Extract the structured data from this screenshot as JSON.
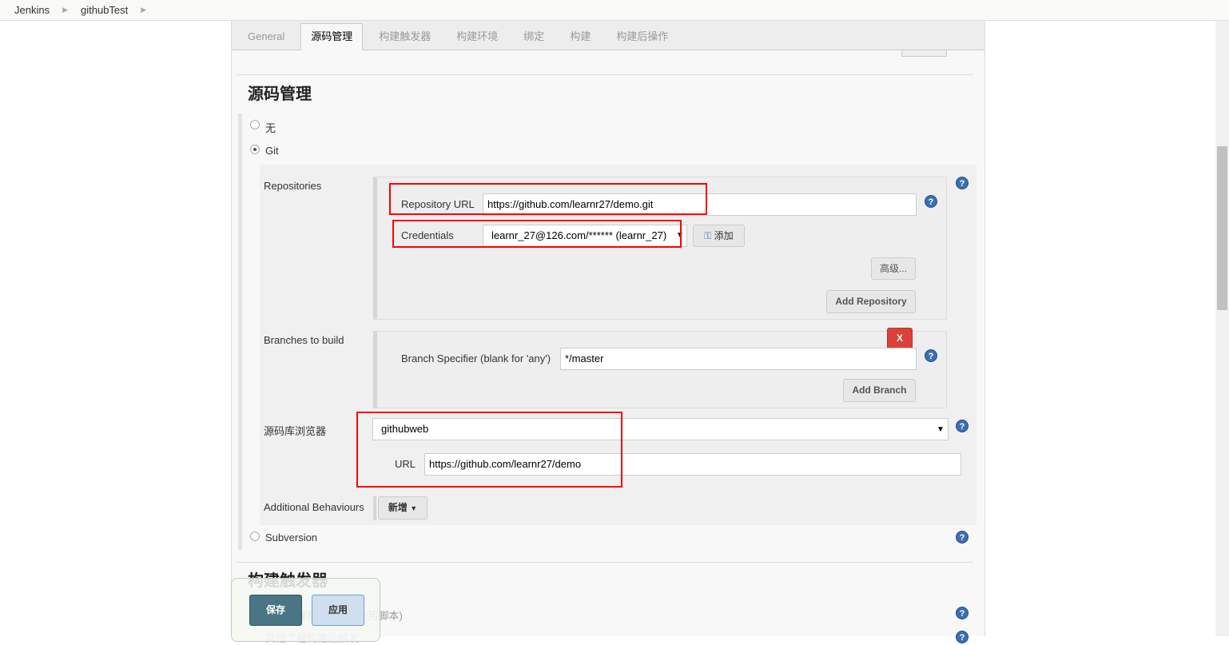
{
  "breadcrumb": [
    "Jenkins",
    "githubTest"
  ],
  "tabs": [
    "General",
    "源码管理",
    "构建触发器",
    "构建环境",
    "绑定",
    "构建",
    "构建后操作"
  ],
  "active_tab": "源码管理",
  "scm": {
    "title": "源码管理",
    "options": {
      "none": "无",
      "git": "Git",
      "svn": "Subversion"
    },
    "selected": "Git",
    "repositories_label": "Repositories",
    "repo_url_label": "Repository URL",
    "repo_url_value": "https://github.com/learnr27/demo.git",
    "credentials_label": "Credentials",
    "credentials_value": "learnr_27@126.com/****** (learnr_27)",
    "add_label": "添加",
    "advanced_label": "高级...",
    "add_repository_label": "Add Repository",
    "branches_label": "Branches to build",
    "branch_specifier_label": "Branch Specifier (blank for 'any')",
    "branch_specifier_value": "*/master",
    "delete_label": "X",
    "add_branch_label": "Add Branch",
    "browser_label": "源码库浏览器",
    "browser_value": "githubweb",
    "url_label": "URL",
    "url_value": "https://github.com/learnr27/demo",
    "behaviours_label": "Additional Behaviours",
    "behaviours_button": "新增"
  },
  "triggers": {
    "title": "构建触发器",
    "items": [
      "触发远程构建 (例如,使用脚本)",
      "其他工程构建后触发"
    ]
  },
  "footer": {
    "save": "保存",
    "apply": "应用"
  },
  "colors": {
    "highlight": "#ff0000",
    "save": "#4a7585",
    "apply": "#cfdff0",
    "help": "#3a6fb0",
    "delete": "#d9413a"
  }
}
